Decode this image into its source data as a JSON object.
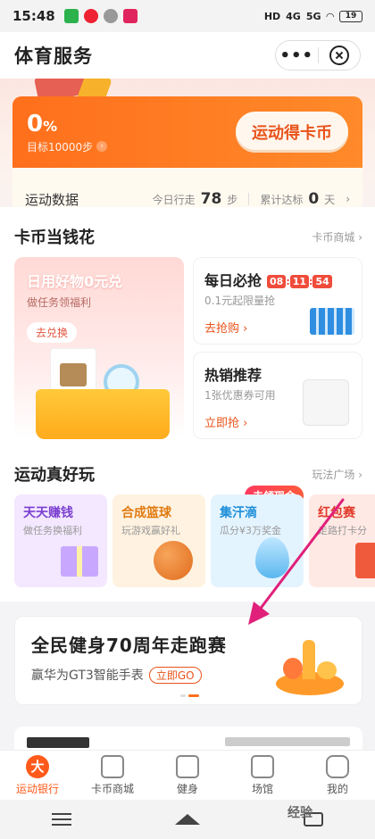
{
  "status_bar": {
    "time": "15:48",
    "network": "4G",
    "network2": "5G",
    "battery": "19"
  },
  "header": {
    "title": "体育服务",
    "more_label": "•••"
  },
  "steps_card": {
    "percent": "0",
    "percent_unit": "%",
    "goal": "目标10000步",
    "cta": "运动得卡币",
    "data_label": "运动数据",
    "today_label": "今日行走",
    "today_value": "78",
    "today_unit": "步",
    "total_label": "累计达标",
    "total_value": "0",
    "total_unit": "天",
    "progress": 0
  },
  "coin_section": {
    "title": "卡币当钱花",
    "link": "卡币商城",
    "big_card": {
      "title": "日用好物0元兑",
      "subtitle": "做任务领福利",
      "button": "去兑换"
    },
    "flash_card": {
      "title": "每日必抢",
      "countdown": [
        "08",
        "11",
        "54"
      ],
      "subtitle": "0.1元起限量抢",
      "button": "去抢购"
    },
    "hot_card": {
      "title": "热销推荐",
      "subtitle": "1张优惠券可用",
      "button": "立即抢"
    }
  },
  "games_section": {
    "title": "运动真好玩",
    "link": "玩法广场",
    "badge": "去领现金",
    "games": [
      {
        "title": "天天赚钱",
        "subtitle": "做任务换福利",
        "color": "#7b3fd0",
        "bg": "#f3e8ff"
      },
      {
        "title": "合成篮球",
        "subtitle": "玩游戏赢好礼",
        "color": "#e07a10",
        "bg": "#fff2e0"
      },
      {
        "title": "集汗滴",
        "subtitle": "瓜分¥3万奖金",
        "color": "#1e8fd8",
        "bg": "#e4f4ff"
      },
      {
        "title": "红包赛",
        "subtitle": "走路打卡分",
        "color": "#e03a2a",
        "bg": "#ffe9e4"
      }
    ]
  },
  "banner": {
    "title": "全民健身70周年走跑赛",
    "subtitle": "赢华为GT3智能手表",
    "button": "立即GO"
  },
  "tabbar": {
    "items": [
      {
        "label": "运动银行",
        "active": true
      },
      {
        "label": "卡币商城",
        "active": false
      },
      {
        "label": "健身",
        "active": false
      },
      {
        "label": "场馆",
        "active": false
      },
      {
        "label": "我的",
        "active": false
      }
    ]
  },
  "watermark": "经验",
  "colors": {
    "accent": "#ff6f1c",
    "red": "#f04c3b",
    "arrow": "#e0207a"
  }
}
